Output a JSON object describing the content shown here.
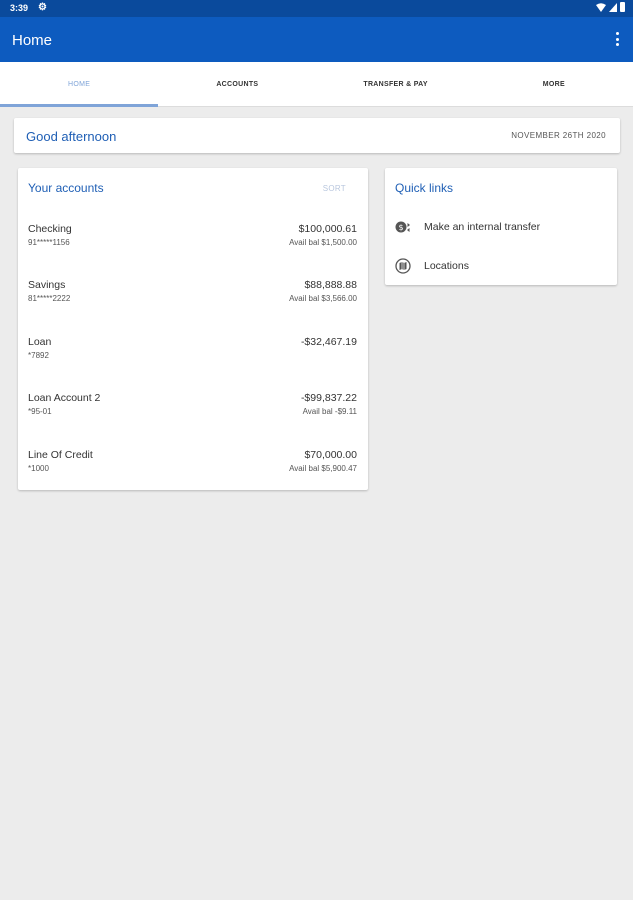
{
  "status_bar": {
    "time": "3:39"
  },
  "app_bar": {
    "title": "Home"
  },
  "tabs": [
    {
      "label": "HOME",
      "active": true
    },
    {
      "label": "ACCOUNTS",
      "active": false
    },
    {
      "label": "TRANSFER & PAY",
      "active": false
    },
    {
      "label": "MORE",
      "active": false
    }
  ],
  "greeting": {
    "text": "Good afternoon",
    "date": "NOVEMBER 26TH 2020"
  },
  "accounts": {
    "title": "Your accounts",
    "sort_label": "SORT",
    "items": [
      {
        "name": "Checking",
        "number": "91*****1156",
        "balance": "$100,000.61",
        "avail": "Avail bal $1,500.00"
      },
      {
        "name": "Savings",
        "number": "81*****2222",
        "balance": "$88,888.88",
        "avail": "Avail bal $3,566.00"
      },
      {
        "name": "Loan",
        "number": "*7892",
        "balance": "-$32,467.19",
        "avail": ""
      },
      {
        "name": "Loan Account 2",
        "number": "*95-01",
        "balance": "-$99,837.22",
        "avail": "Avail bal -$9.11"
      },
      {
        "name": "Line Of Credit",
        "number": "*1000",
        "balance": "$70,000.00",
        "avail": "Avail bal $5,900.47"
      }
    ]
  },
  "quick_links": {
    "title": "Quick links",
    "items": [
      {
        "label": "Make an internal transfer",
        "icon": "transfer-icon"
      },
      {
        "label": "Locations",
        "icon": "map-icon"
      }
    ]
  },
  "colors": {
    "status_bar": "#0a4a9c",
    "app_bar": "#0d5bbf",
    "accent": "#1f5fb5",
    "tab_active": "#7fa4d8",
    "background": "#ececec"
  }
}
